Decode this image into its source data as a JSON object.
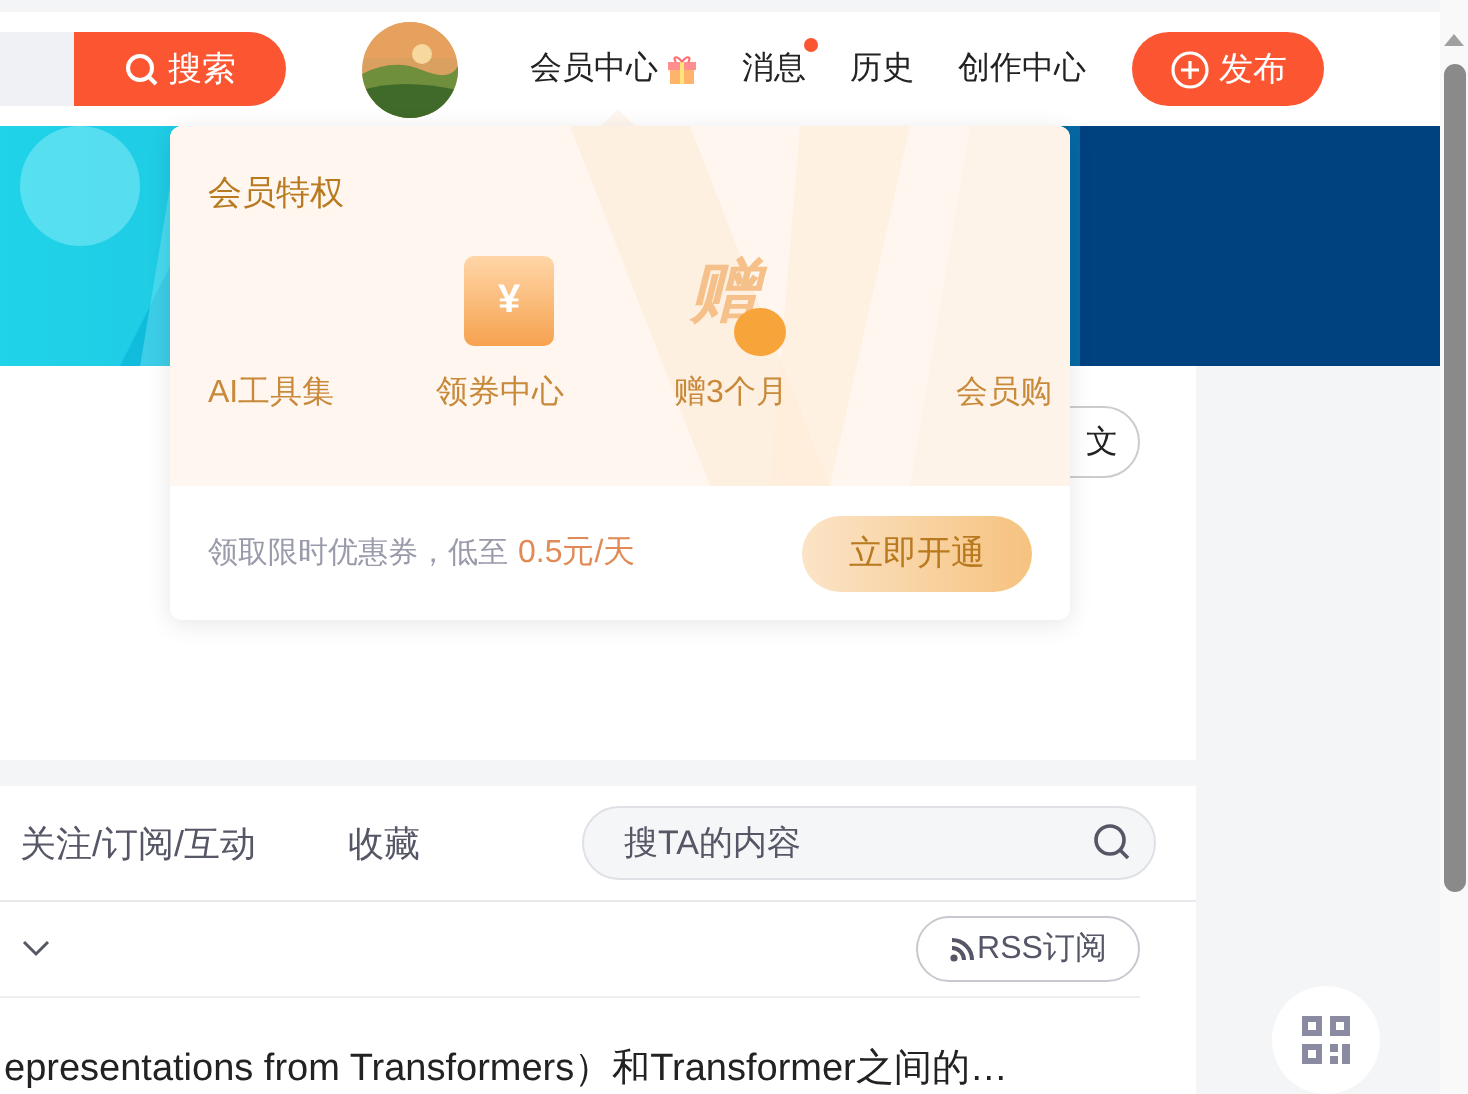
{
  "header": {
    "search_button": "搜索",
    "nav": [
      {
        "label": "会员中心",
        "kind": "gift",
        "has_dot": false
      },
      {
        "label": "消息",
        "kind": "plain",
        "has_dot": true
      },
      {
        "label": "历史",
        "kind": "plain",
        "has_dot": false
      },
      {
        "label": "创作中心",
        "kind": "plain",
        "has_dot": false
      }
    ],
    "publish_button": "发布"
  },
  "profile": {
    "action_button": "文"
  },
  "vip_popup": {
    "title": "会员特权",
    "perks": [
      {
        "label": "AI工具集",
        "kind": "none"
      },
      {
        "label": "领券中心",
        "kind": "ticket",
        "glyph": "¥"
      },
      {
        "label": "赠3个月",
        "kind": "gift_badge",
        "glyph": "赠"
      },
      {
        "label": "会员购",
        "kind": "none"
      }
    ],
    "promo_text": "领取限时优惠券，低至",
    "promo_price": "0.5元/天",
    "open_button": "立即开通"
  },
  "tabs": [
    {
      "label": "关注/订阅/互动",
      "selected": false
    },
    {
      "label": "收藏",
      "selected": false
    }
  ],
  "content_search": {
    "placeholder": "搜TA的内容"
  },
  "rss_button": "RSS订阅",
  "article_title": "epresentations from Transformers）和Transformer之间的…"
}
